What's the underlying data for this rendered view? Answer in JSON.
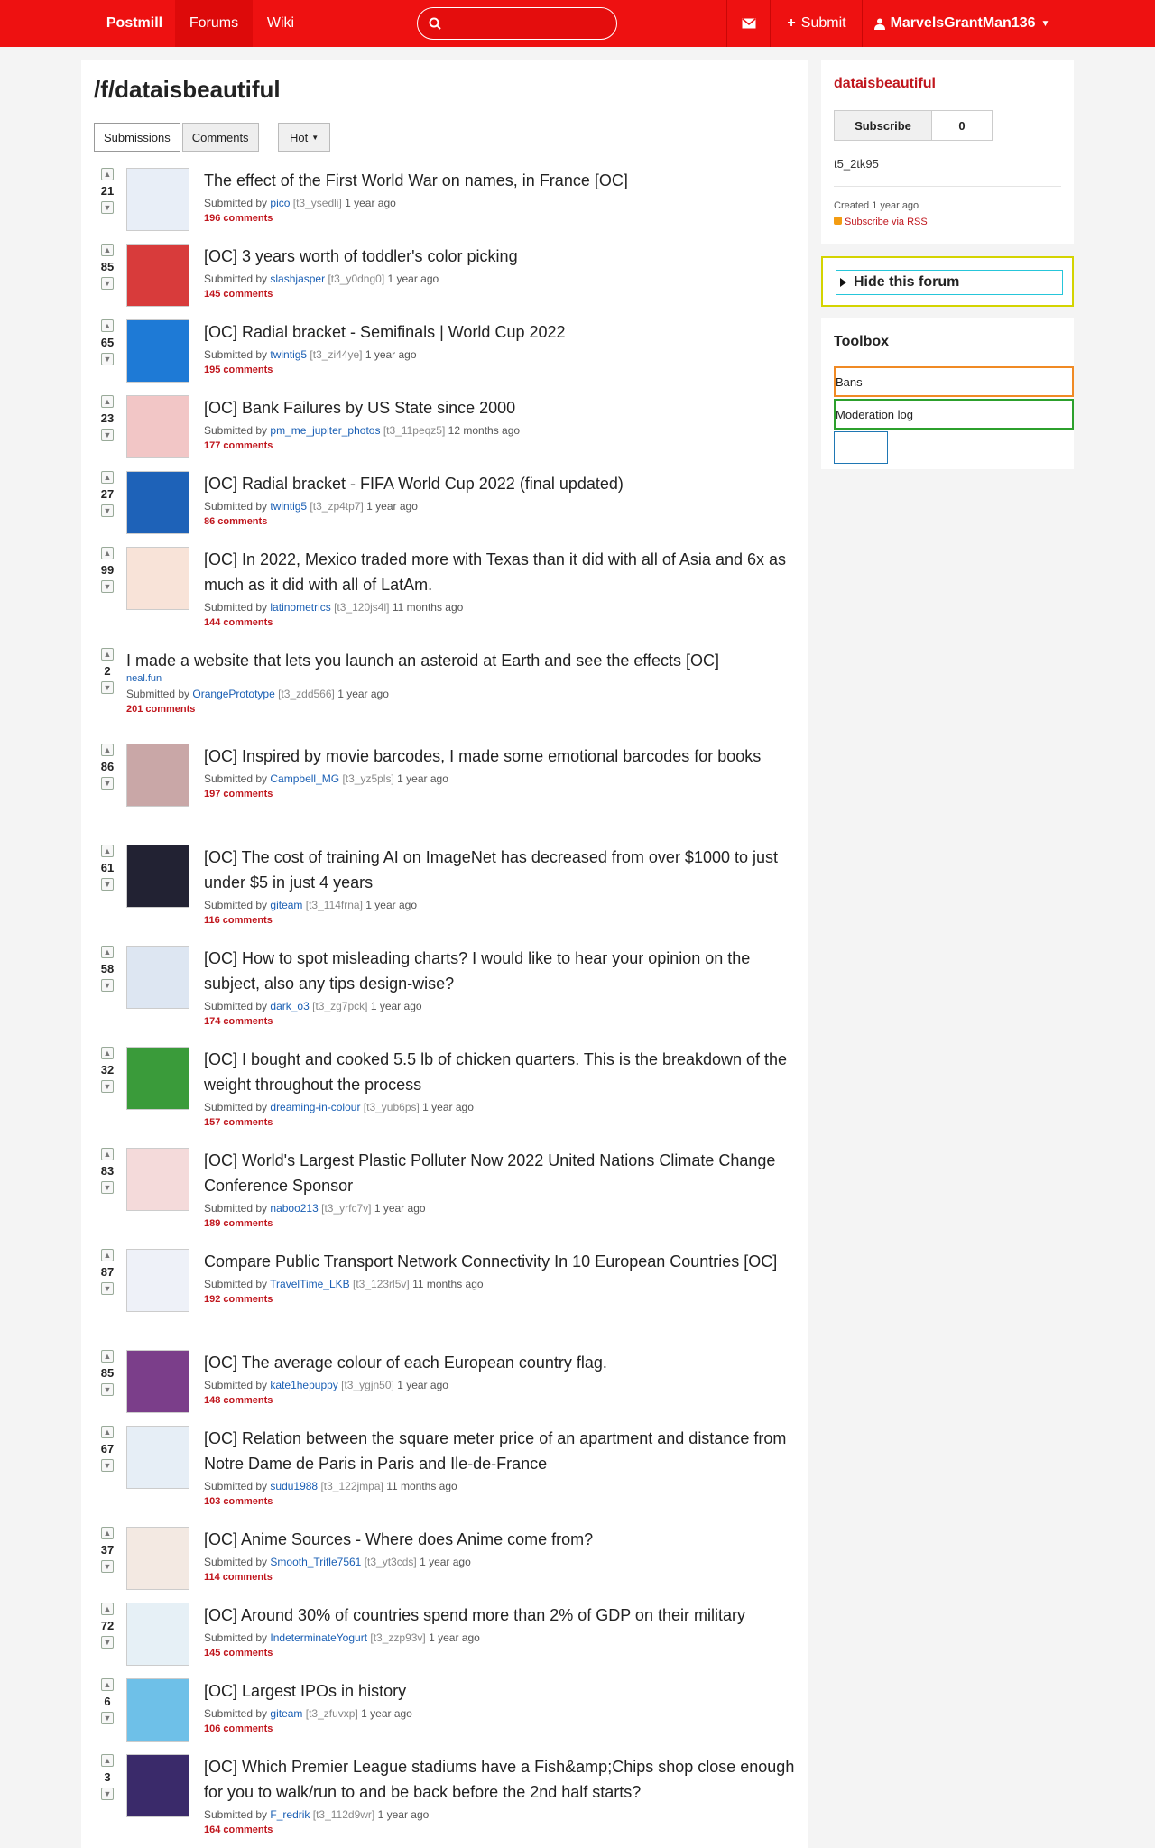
{
  "navbar": {
    "brand": "Postmill",
    "forums": "Forums",
    "wiki": "Wiki",
    "search_placeholder": "",
    "submit": "Submit",
    "user": "MarvelsGrantMan136"
  },
  "forum": {
    "title": "/f/dataisbeautiful",
    "tabs": [
      "Submissions",
      "Comments"
    ],
    "sort": "Hot"
  },
  "posts": [
    {
      "score": "21",
      "title": "The effect of the First World War on names, in France [OC]",
      "author": "pico",
      "tid": "[t3_ysedli]",
      "time": "1 year ago",
      "comments": "196 comments"
    },
    {
      "score": "85",
      "title": "[OC] 3 years worth of toddler's color picking",
      "author": "slashjasper",
      "tid": "[t3_y0dng0]",
      "time": "1 year ago",
      "comments": "145 comments"
    },
    {
      "score": "65",
      "title": "[OC] Radial bracket - Semifinals | World Cup 2022",
      "author": "twintig5",
      "tid": "[t3_zi44ye]",
      "time": "1 year ago",
      "comments": "195 comments"
    },
    {
      "score": "23",
      "title": "[OC] Bank Failures by US State since 2000",
      "author": "pm_me_jupiter_photos",
      "tid": "[t3_11peqz5]",
      "time": "12 months ago",
      "comments": "177 comments"
    },
    {
      "score": "27",
      "title": "[OC] Radial bracket - FIFA World Cup 2022 (final updated)",
      "author": "twintig5",
      "tid": "[t3_zp4tp7]",
      "time": "1 year ago",
      "comments": "86 comments"
    },
    {
      "score": "99",
      "title": "[OC] In 2022, Mexico traded more with Texas than it did with all of Asia and 6x as much as it did with all of LatAm.",
      "author": "latinometrics",
      "tid": "[t3_120js4l]",
      "time": "11 months ago",
      "comments": "144 comments"
    },
    {
      "score": "2",
      "title": "I made a website that lets you launch an asteroid at Earth and see the effects [OC]",
      "domain": "neal.fun",
      "author": "OrangePrototype",
      "tid": "[t3_zdd566]",
      "time": "1 year ago",
      "comments": "201 comments"
    },
    {
      "score": "86",
      "title": "[OC] Inspired by movie barcodes, I made some emotional barcodes for books",
      "author": "Campbell_MG",
      "tid": "[t3_yz5pls]",
      "time": "1 year ago",
      "comments": "197 comments"
    },
    {
      "score": "61",
      "title": "[OC] The cost of training AI on ImageNet has decreased from over $1000 to just under $5 in just 4 years",
      "author": "giteam",
      "tid": "[t3_114frna]",
      "time": "1 year ago",
      "comments": "116 comments"
    },
    {
      "score": "58",
      "title": "[OC] How to spot misleading charts? I would like to hear your opinion on the subject, also any tips design-wise?",
      "author": "dark_o3",
      "tid": "[t3_zg7pck]",
      "time": "1 year ago",
      "comments": "174 comments"
    },
    {
      "score": "32",
      "title": "[OC] I bought and cooked 5.5 lb of chicken quarters. This is the breakdown of the weight throughout the process",
      "author": "dreaming-in-colour",
      "tid": "[t3_yub6ps]",
      "time": "1 year ago",
      "comments": "157 comments"
    },
    {
      "score": "83",
      "title": "[OC] World's Largest Plastic Polluter Now 2022 United Nations Climate Change Conference Sponsor",
      "author": "naboo213",
      "tid": "[t3_yrfc7v]",
      "time": "1 year ago",
      "comments": "189 comments"
    },
    {
      "score": "87",
      "title": "Compare Public Transport Network Connectivity In 10 European Countries [OC]",
      "author": "TravelTime_LKB",
      "tid": "[t3_123rl5v]",
      "time": "11 months ago",
      "comments": "192 comments"
    },
    {
      "score": "85",
      "title": "[OC] The average colour of each European country flag.",
      "author": "kate1hepuppy",
      "tid": "[t3_ygjn50]",
      "time": "1 year ago",
      "comments": "148 comments"
    },
    {
      "score": "67",
      "title": "[OC] Relation between the square meter price of an apartment and distance from Notre Dame de Paris in Paris and Ile-de-France",
      "author": "sudu1988",
      "tid": "[t3_122jmpa]",
      "time": "11 months ago",
      "comments": "103 comments"
    },
    {
      "score": "37",
      "title": "[OC] Anime Sources - Where does Anime come from?",
      "author": "Smooth_Trifle7561",
      "tid": "[t3_yt3cds]",
      "time": "1 year ago",
      "comments": "114 comments"
    },
    {
      "score": "72",
      "title": "[OC] Around 30% of countries spend more than 2% of GDP on their military",
      "author": "IndeterminateYogurt",
      "tid": "[t3_zzp93v]",
      "time": "1 year ago",
      "comments": "145 comments"
    },
    {
      "score": "6",
      "title": "[OC] Largest IPOs in history",
      "author": "giteam",
      "tid": "[t3_zfuvxp]",
      "time": "1 year ago",
      "comments": "106 comments"
    },
    {
      "score": "3",
      "title": "[OC] Which Premier League stadiums have a Fish&amp;Chips shop close enough for you to walk/run to and be back before the 2nd half starts?",
      "author": "F_redrik",
      "tid": "[t3_112d9wr]",
      "time": "1 year ago",
      "comments": "164 comments"
    }
  ],
  "meta_labels": {
    "submitted_by": "Submitted by"
  },
  "sidebar": {
    "title": "dataisbeautiful",
    "subscribe": "Subscribe",
    "subscribers": "0",
    "forum_id": "t5_2tk95",
    "created": "Created 1 year ago",
    "rss": "Subscribe via RSS",
    "hide": "Hide this forum",
    "toolbox_title": "Toolbox",
    "bans": "Bans",
    "modlog": "Moderation log"
  },
  "colors": {
    "brand_red": "#ee1111",
    "link_red": "#c0161d",
    "author_blue": "#1a5fb4"
  }
}
